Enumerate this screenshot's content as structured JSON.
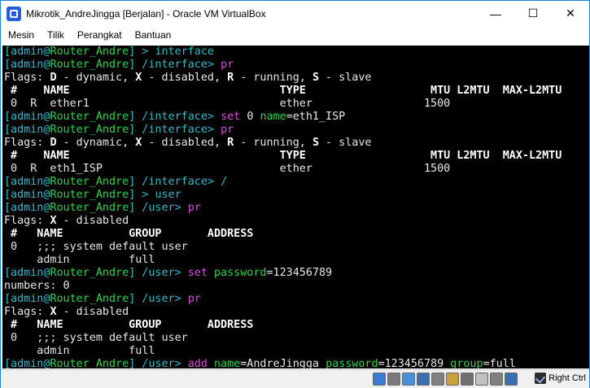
{
  "window": {
    "title": "Mikrotik_AndreJingga [Berjalan] - Oracle VM VirtualBox",
    "controls": {
      "minimize": "—",
      "maximize": "☐",
      "close": "✕"
    }
  },
  "menu": [
    "Mesin",
    "Tilik",
    "Perangkat",
    "Bantuan"
  ],
  "console": {
    "lines": [
      [
        [
          "[admin@",
          "cyan"
        ],
        [
          "Router_Andre",
          "green"
        ],
        [
          "] > ",
          "cyan"
        ],
        [
          "interface",
          "cyan"
        ]
      ],
      [
        [
          "[admin@",
          "cyan"
        ],
        [
          "Router_Andre",
          "green"
        ],
        [
          "] /interface> ",
          "cyan"
        ],
        [
          "pr",
          "magenta"
        ]
      ],
      [
        [
          "Flags: ",
          "white"
        ],
        [
          "D",
          "bold"
        ],
        [
          " - dynamic, ",
          "white"
        ],
        [
          "X",
          "bold"
        ],
        [
          " - disabled, ",
          "white"
        ],
        [
          "R",
          "bold"
        ],
        [
          " - running, ",
          "white"
        ],
        [
          "S",
          "bold"
        ],
        [
          " - slave",
          "white"
        ]
      ],
      [
        [
          " #    NAME                                TYPE                   MTU L2MTU  MAX-L2MTU",
          "bold"
        ]
      ],
      [
        [
          " 0  R  ether1                             ether                 1500",
          "white"
        ]
      ],
      [
        [
          "[admin@",
          "cyan"
        ],
        [
          "Router_Andre",
          "green"
        ],
        [
          "] /interface> ",
          "cyan"
        ],
        [
          "set ",
          "magenta"
        ],
        [
          "0 ",
          "white"
        ],
        [
          "name",
          "green"
        ],
        [
          "=eth1_ISP",
          "white"
        ]
      ],
      [
        [
          "[admin@",
          "cyan"
        ],
        [
          "Router_Andre",
          "green"
        ],
        [
          "] /interface> ",
          "cyan"
        ],
        [
          "pr",
          "magenta"
        ]
      ],
      [
        [
          "Flags: ",
          "white"
        ],
        [
          "D",
          "bold"
        ],
        [
          " - dynamic, ",
          "white"
        ],
        [
          "X",
          "bold"
        ],
        [
          " - disabled, ",
          "white"
        ],
        [
          "R",
          "bold"
        ],
        [
          " - running, ",
          "white"
        ],
        [
          "S",
          "bold"
        ],
        [
          " - slave",
          "white"
        ]
      ],
      [
        [
          " #    NAME                                TYPE                   MTU L2MTU  MAX-L2MTU",
          "bold"
        ]
      ],
      [
        [
          " 0  R  eth1_ISP                           ether                 1500",
          "white"
        ]
      ],
      [
        [
          "[admin@",
          "cyan"
        ],
        [
          "Router_Andre",
          "green"
        ],
        [
          "] /interface> ",
          "cyan"
        ],
        [
          "/",
          "cyan"
        ]
      ],
      [
        [
          "[admin@",
          "cyan"
        ],
        [
          "Router_Andre",
          "green"
        ],
        [
          "] > ",
          "cyan"
        ],
        [
          "user",
          "cyan"
        ]
      ],
      [
        [
          "[admin@",
          "cyan"
        ],
        [
          "Router_Andre",
          "green"
        ],
        [
          "] /user> ",
          "cyan"
        ],
        [
          "pr",
          "magenta"
        ]
      ],
      [
        [
          "Flags: ",
          "white"
        ],
        [
          "X",
          "bold"
        ],
        [
          " - disabled",
          "white"
        ]
      ],
      [
        [
          " #   NAME          GROUP       ADDRESS",
          "bold"
        ]
      ],
      [
        [
          " 0   ;;; system default user",
          "white"
        ]
      ],
      [
        [
          "     admin         full",
          "white"
        ]
      ],
      [
        [
          "[admin@",
          "cyan"
        ],
        [
          "Router_Andre",
          "green"
        ],
        [
          "] /user> ",
          "cyan"
        ],
        [
          "set ",
          "magenta"
        ],
        [
          "password",
          "green"
        ],
        [
          "=123456789",
          "white"
        ]
      ],
      [
        [
          "numbers: 0",
          "white"
        ]
      ],
      [
        [
          "[admin@",
          "cyan"
        ],
        [
          "Router_Andre",
          "green"
        ],
        [
          "] /user> ",
          "cyan"
        ],
        [
          "pr",
          "magenta"
        ]
      ],
      [
        [
          "Flags: ",
          "white"
        ],
        [
          "X",
          "bold"
        ],
        [
          " - disabled",
          "white"
        ]
      ],
      [
        [
          " #   NAME          GROUP       ADDRESS",
          "bold"
        ]
      ],
      [
        [
          " 0   ;;; system default user",
          "white"
        ]
      ],
      [
        [
          "     admin         full",
          "white"
        ]
      ],
      [
        [
          "[admin@",
          "cyan"
        ],
        [
          "Router_Andre",
          "green"
        ],
        [
          "] /user> ",
          "cyan"
        ],
        [
          "add ",
          "magenta"
        ],
        [
          "name",
          "green"
        ],
        [
          "=AndreJingga ",
          "white"
        ],
        [
          "password",
          "green"
        ],
        [
          "=123456789 ",
          "white"
        ],
        [
          "group",
          "green"
        ],
        [
          "=full_",
          "white"
        ]
      ]
    ]
  },
  "statusbar": {
    "icons": [
      "hdd-icon",
      "optical-drive-icon",
      "audio-icon",
      "network-icon",
      "usb-icon",
      "shared-folder-icon",
      "display-icon",
      "recording-icon",
      "cpu-icon",
      "mouse-integration-icon"
    ],
    "host_key": "Right Ctrl"
  },
  "colors": {
    "cyan": "#35b8c8",
    "green": "#2fd44a",
    "magenta": "#d64fd6",
    "white": "#e8e8e8",
    "bold": "#ffffff",
    "window_border": "#1883d7"
  }
}
